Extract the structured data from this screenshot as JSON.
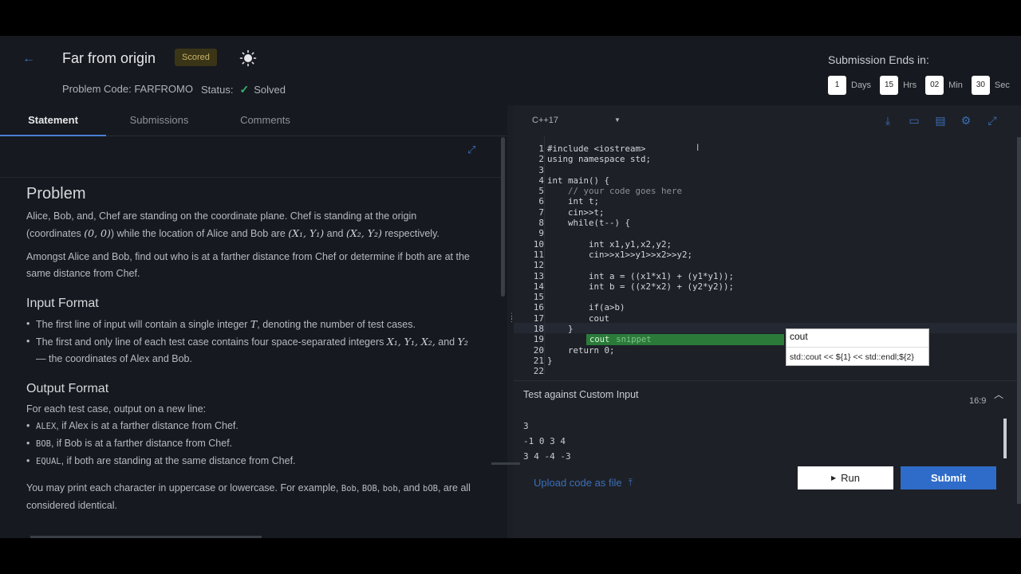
{
  "header": {
    "title": "Far from origin",
    "badge": "Scored",
    "problem_code": "Problem Code: FARFROMO",
    "status_label": "Status:",
    "status_value": "Solved"
  },
  "timer": {
    "title": "Submission Ends in:",
    "units": [
      {
        "value": "1",
        "label": "Days"
      },
      {
        "value": "15",
        "label": "Hrs"
      },
      {
        "value": "02",
        "label": "Min"
      },
      {
        "value": "30",
        "label": "Sec"
      }
    ]
  },
  "tabs": [
    "Statement",
    "Submissions",
    "Comments"
  ],
  "statement": {
    "problem_heading": "Problem",
    "p1_a": "Alice, Bob, and, Chef are standing on the coordinate plane. Chef is standing at the origin (coordinates",
    "p1_m1": "(0, 0)",
    "p1_b": "while the location of Alice and Bob are",
    "p1_m2": "(X₁, Y₁)",
    "p1_c": "and",
    "p1_m3": "(X₂, Y₂)",
    "p1_d": "respectively.",
    "p2": "Amongst Alice and Bob, find out who is at a farther distance from Chef or determine if both are at the same distance from Chef.",
    "input_heading": "Input Format",
    "input_li1_a": "The first line of input will contain a single integer",
    "input_li1_m": "T",
    "input_li1_b": ", denoting the number of test cases.",
    "input_li2_a": "The first and only line of each test case contains four space-separated integers",
    "input_li2_m": "X₁, Y₁, X₂,",
    "input_li2_b": "and",
    "input_li2_m2": "Y₂",
    "input_li2_c": "— the coordinates of Alex and Bob.",
    "output_heading": "Output Format",
    "output_intro": "For each test case, output on a new line:",
    "out1_code": "ALEX",
    "out1_text": ", if Alex is at a farther distance from Chef.",
    "out2_code": "BOB",
    "out2_text": ", if Bob is at a farther distance from Chef.",
    "out3_code": "EQUAL",
    "out3_text": ", if both are standing at the same distance from Chef.",
    "case_a": "You may print each character in uppercase or lowercase. For example,",
    "case_c1": "Bob",
    "case_c2": "BOB",
    "case_c3": "bob",
    "case_and": "and",
    "case_c4": "bOB",
    "case_b": ", are all considered identical."
  },
  "editor": {
    "language": "C++17",
    "code_lines": [
      "#include <iostream>",
      "using namespace std;",
      "",
      "int main() {",
      "    // your code goes here",
      "    int t;",
      "    cin>>t;",
      "    while(t--) {",
      "",
      "        int x1,y1,x2,y2;",
      "        cin>>x1>>y1>>x2>>y2;",
      "",
      "        int a = ((x1*x1) + (y1*y1));",
      "        int b = ((x2*x2) + (y2*y2));",
      "",
      "        if(a>b)",
      "        cout",
      "    }",
      "",
      "    return 0;",
      "}",
      ""
    ],
    "suggestion_word": "cout",
    "suggestion_kind": "snippet",
    "tooltip_title": "cout",
    "tooltip_body": "std::cout << ${1} << std::endl;${2}",
    "aspect": "16:9"
  },
  "custom_input": {
    "title": "Test against Custom Input",
    "lines": [
      "3",
      "-1 0 3 4",
      "3 4 -4 -3"
    ]
  },
  "footer": {
    "upload_label": "Upload code as file",
    "run_label": "Run",
    "submit_label": "Submit"
  }
}
